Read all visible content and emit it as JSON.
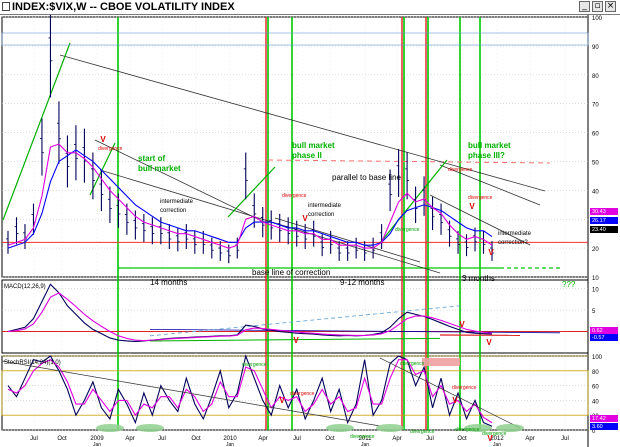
{
  "window": {
    "title": "INDEX:$VIX,W -- CBOE VOLATILITY INDEX",
    "minimize": "_",
    "restore": "▫",
    "close": "×"
  },
  "chart_data": {
    "type": "line",
    "subtitle_macd": "MACD(12,26,9)",
    "subtitle_stoch": "StochRSI(14,24)(1,0)",
    "x_labels": [
      "Jul",
      "Oct",
      "2009",
      "Apr",
      "Jul",
      "Oct",
      "2010",
      "Apr",
      "Jul",
      "Oct",
      "2011",
      "Apr",
      "Jul",
      "Oct",
      "2012",
      "Apr",
      "Jul"
    ],
    "x_sub_labels": [
      "Jan",
      "Jan",
      "Jan",
      "Jan"
    ],
    "price_axis": {
      "ylim": [
        10,
        100
      ],
      "ticks": [
        100,
        90,
        80,
        70,
        60,
        50,
        40,
        30,
        20,
        10
      ]
    },
    "macd_axis": {
      "ylim": [
        -5,
        12
      ],
      "ticks": [
        10,
        5,
        0
      ]
    },
    "stoch_axis": {
      "ylim": [
        0,
        100
      ],
      "ticks": [
        100,
        80,
        60,
        40,
        20,
        0
      ]
    },
    "price_readouts": [
      "30.43",
      "26.17",
      "23.40"
    ],
    "macd_readouts": [
      "0.62",
      "-0.57"
    ],
    "stoch_readouts": [
      "17.42",
      "3.60"
    ],
    "price_series": [
      {
        "color": "#00005a",
        "values": [
          22,
          26,
          24,
          30,
          55,
          88,
          60,
          50,
          53,
          52,
          45,
          40,
          35,
          33,
          30,
          28,
          27,
          26,
          26,
          24,
          23,
          24,
          22,
          22,
          20,
          19,
          18,
          20,
          45,
          33,
          29,
          28,
          27,
          26,
          25,
          24,
          25,
          21,
          22,
          19,
          19,
          20,
          19,
          20,
          24,
          40,
          46,
          45,
          35,
          38,
          32,
          30,
          25,
          22,
          21,
          23,
          22,
          19
        ]
      },
      {
        "color": "#0000ff",
        "values": [
          20,
          21,
          22,
          25,
          32,
          43,
          50,
          52,
          54,
          52,
          50,
          47,
          44,
          41,
          38,
          35,
          33,
          31,
          29,
          28,
          27,
          26,
          26,
          25,
          24,
          23,
          22,
          22,
          27,
          29,
          29,
          29,
          28,
          27,
          27,
          26,
          26,
          25,
          24,
          23,
          22,
          22,
          21,
          21,
          22,
          25,
          30,
          33,
          34,
          35,
          34,
          33,
          31,
          29,
          27,
          26,
          26,
          24
        ]
      },
      {
        "color": "#e000e0",
        "values": [
          21,
          22,
          23,
          27,
          38,
          55,
          56,
          53,
          53,
          51,
          48,
          44,
          40,
          37,
          34,
          31,
          29,
          28,
          27,
          26,
          25,
          25,
          24,
          23,
          22,
          21,
          20,
          21,
          30,
          31,
          29,
          28,
          27,
          26,
          26,
          25,
          25,
          23,
          23,
          21,
          21,
          21,
          20,
          20,
          22,
          29,
          36,
          39,
          36,
          37,
          34,
          32,
          28,
          25,
          23,
          24,
          23,
          21
        ]
      }
    ],
    "macd_series": [
      {
        "name": "MACD",
        "color": "#00005a",
        "values": [
          0,
          0.5,
          1,
          3,
          7,
          11,
          9,
          6,
          4,
          2,
          0.5,
          -0.5,
          -1.5,
          -2,
          -2.2,
          -2.3,
          -2.2,
          -2,
          -1.8,
          -1.6,
          -1.5,
          -1.4,
          -1.3,
          -1.2,
          -1.1,
          -1,
          -1,
          -0.8,
          1.5,
          1.2,
          0.6,
          0.3,
          0,
          -0.2,
          -0.4,
          -0.5,
          -0.6,
          -0.8,
          -0.9,
          -1,
          -0.9,
          -1,
          -0.9,
          -0.7,
          -0.3,
          1,
          3,
          4.5,
          4,
          3.5,
          2.8,
          2,
          1.2,
          0.5,
          -0.2,
          -0.4,
          -0.5,
          -0.57
        ]
      },
      {
        "name": "Signal",
        "color": "#e000e0",
        "values": [
          0,
          0.2,
          0.6,
          1.8,
          4.5,
          8,
          9,
          7.5,
          5.8,
          4,
          2.5,
          1.2,
          0,
          -1,
          -1.6,
          -2,
          -2.1,
          -2,
          -1.9,
          -1.7,
          -1.6,
          -1.5,
          -1.4,
          -1.3,
          -1.2,
          -1.1,
          -1.05,
          -0.9,
          0.4,
          0.8,
          0.7,
          0.5,
          0.3,
          0.1,
          -0.1,
          -0.3,
          -0.4,
          -0.6,
          -0.7,
          -0.8,
          -0.85,
          -0.9,
          -0.9,
          -0.8,
          -0.55,
          0.2,
          1.6,
          3,
          3.6,
          3.6,
          3.2,
          2.6,
          1.9,
          1.2,
          0.5,
          0.1,
          -0.2,
          -0.4
        ]
      }
    ],
    "stoch_series": [
      {
        "name": "StochRSI",
        "color": "#00005a",
        "values": [
          60,
          45,
          70,
          95,
          92,
          100,
          80,
          55,
          20,
          40,
          65,
          30,
          15,
          55,
          35,
          10,
          50,
          20,
          60,
          40,
          25,
          70,
          35,
          15,
          45,
          80,
          30,
          50,
          100,
          70,
          40,
          20,
          60,
          30,
          55,
          15,
          40,
          70,
          25,
          55,
          10,
          35,
          95,
          20,
          40,
          90,
          100,
          95,
          60,
          85,
          30,
          70,
          20,
          50,
          15,
          40,
          10,
          5
        ]
      },
      {
        "name": "Signal",
        "color": "#e000e0",
        "values": [
          55,
          50,
          60,
          80,
          90,
          95,
          85,
          65,
          35,
          35,
          55,
          40,
          25,
          40,
          40,
          20,
          35,
          30,
          45,
          45,
          30,
          55,
          45,
          25,
          35,
          65,
          45,
          45,
          85,
          80,
          55,
          30,
          45,
          40,
          45,
          25,
          35,
          55,
          35,
          45,
          25,
          30,
          70,
          35,
          35,
          70,
          95,
          95,
          75,
          80,
          45,
          60,
          35,
          40,
          25,
          35,
          17,
          10
        ]
      }
    ],
    "annotations": [
      {
        "text": "start of",
        "color": "#00b000"
      },
      {
        "text": "bull market",
        "color": "#00b000"
      },
      {
        "text": "bull market",
        "color": "#00b000"
      },
      {
        "text": "phase II",
        "color": "#00b000"
      },
      {
        "text": "bull market",
        "color": "#00b000"
      },
      {
        "text": "phase III?",
        "color": "#00b000"
      },
      {
        "text": "parallel to base line",
        "color": "#000000"
      },
      {
        "text": "intermediate",
        "color": "#000000"
      },
      {
        "text": "correction",
        "color": "#000000"
      },
      {
        "text": "intermediate",
        "color": "#000000"
      },
      {
        "text": "correction",
        "color": "#000000"
      },
      {
        "text": "intermediate",
        "color": "#000000"
      },
      {
        "text": "correction?",
        "color": "#000000"
      },
      {
        "text": "14 months",
        "color": "#000000"
      },
      {
        "text": "base line of correction",
        "color": "#000000"
      },
      {
        "text": "9-12 months",
        "color": "#000000"
      },
      {
        "text": "3 months",
        "color": "#000000"
      },
      {
        "text": "???",
        "color": "#00b000"
      },
      {
        "text": "divergence",
        "color": "#e00000"
      },
      {
        "text": "divergence",
        "color": "#e00000"
      },
      {
        "text": "divergence",
        "color": "#00a000"
      },
      {
        "text": "divergence",
        "color": "#e00000"
      },
      {
        "text": "divergence",
        "color": "#e00000"
      },
      {
        "text": "divergence",
        "color": "#00a000"
      },
      {
        "text": "divergence",
        "color": "#00a000"
      },
      {
        "text": "divergence",
        "color": "#e00000"
      },
      {
        "text": "divergence",
        "color": "#00a000"
      },
      {
        "text": "divergence",
        "color": "#00a000"
      },
      {
        "text": "divergence",
        "color": "#e00000"
      },
      {
        "text": "divergence",
        "color": "#00a000"
      },
      {
        "text": "divergence",
        "color": "#00a000"
      }
    ],
    "marker": "V"
  }
}
